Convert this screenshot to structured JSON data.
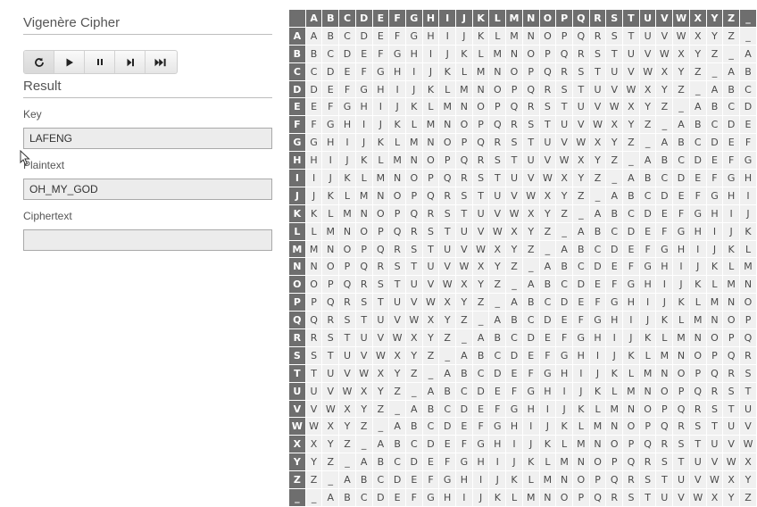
{
  "app": {
    "title": "Vigenère Cipher",
    "result_title": "Result"
  },
  "controls": [
    {
      "name": "reset-button",
      "icon": "reset-icon",
      "glyph": "↻"
    },
    {
      "name": "play-button",
      "icon": "play-icon",
      "glyph": "▶"
    },
    {
      "name": "pause-button",
      "icon": "pause-icon",
      "glyph": "❚❚"
    },
    {
      "name": "step-button",
      "icon": "step-icon",
      "glyph": "▶❙"
    },
    {
      "name": "fast-forward-button",
      "icon": "fast-forward-icon",
      "glyph": "▶▶❙"
    }
  ],
  "fields": {
    "key_label": "Key",
    "key_value": "LAFENG",
    "plaintext_label": "Plaintext",
    "plaintext_value": "OH_MY_GOD",
    "ciphertext_label": "Ciphertext",
    "ciphertext_value": ""
  },
  "tableau": {
    "alphabet": "ABCDEFGHIJKLMNOPQRSTUVWXYZ_"
  },
  "colors": {
    "header_bg": "#6e6e6e",
    "cell_bg": "#f0f0f0",
    "field_bg": "#ececec"
  }
}
